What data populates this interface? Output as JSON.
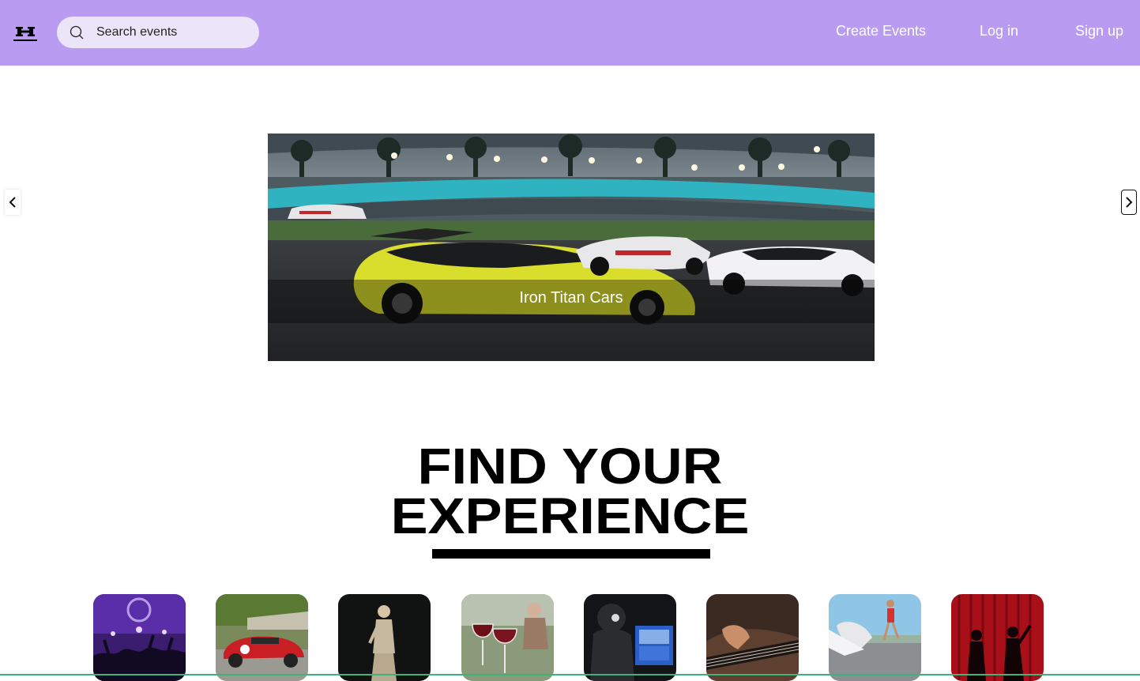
{
  "header": {
    "logo_icon": "h-logo-icon",
    "search": {
      "icon": "search-icon",
      "placeholder": "Search events",
      "value": ""
    },
    "nav": {
      "create_events": "Create Events",
      "log_in": "Log in",
      "sign_up": "Sign up"
    },
    "background_color": "#b99cf2"
  },
  "carousel": {
    "prev_icon": "chevron-left-icon",
    "next_icon": "chevron-right-icon",
    "slide": {
      "caption": "Iron Titan Cars",
      "image": "race-cars-on-track-photo"
    }
  },
  "section": {
    "title_line1": "FIND YOUR",
    "title_line2": "EXPERIENCE"
  },
  "categories": [
    {
      "image": "concert-crowd-photo"
    },
    {
      "image": "classic-race-car-photo"
    },
    {
      "image": "fashion-runway-photo"
    },
    {
      "image": "wine-glasses-photo"
    },
    {
      "image": "dj-gaming-setup-photo"
    },
    {
      "image": "guitar-player-photo"
    },
    {
      "image": "running-race-photo"
    },
    {
      "image": "theatre-stage-photo"
    }
  ]
}
